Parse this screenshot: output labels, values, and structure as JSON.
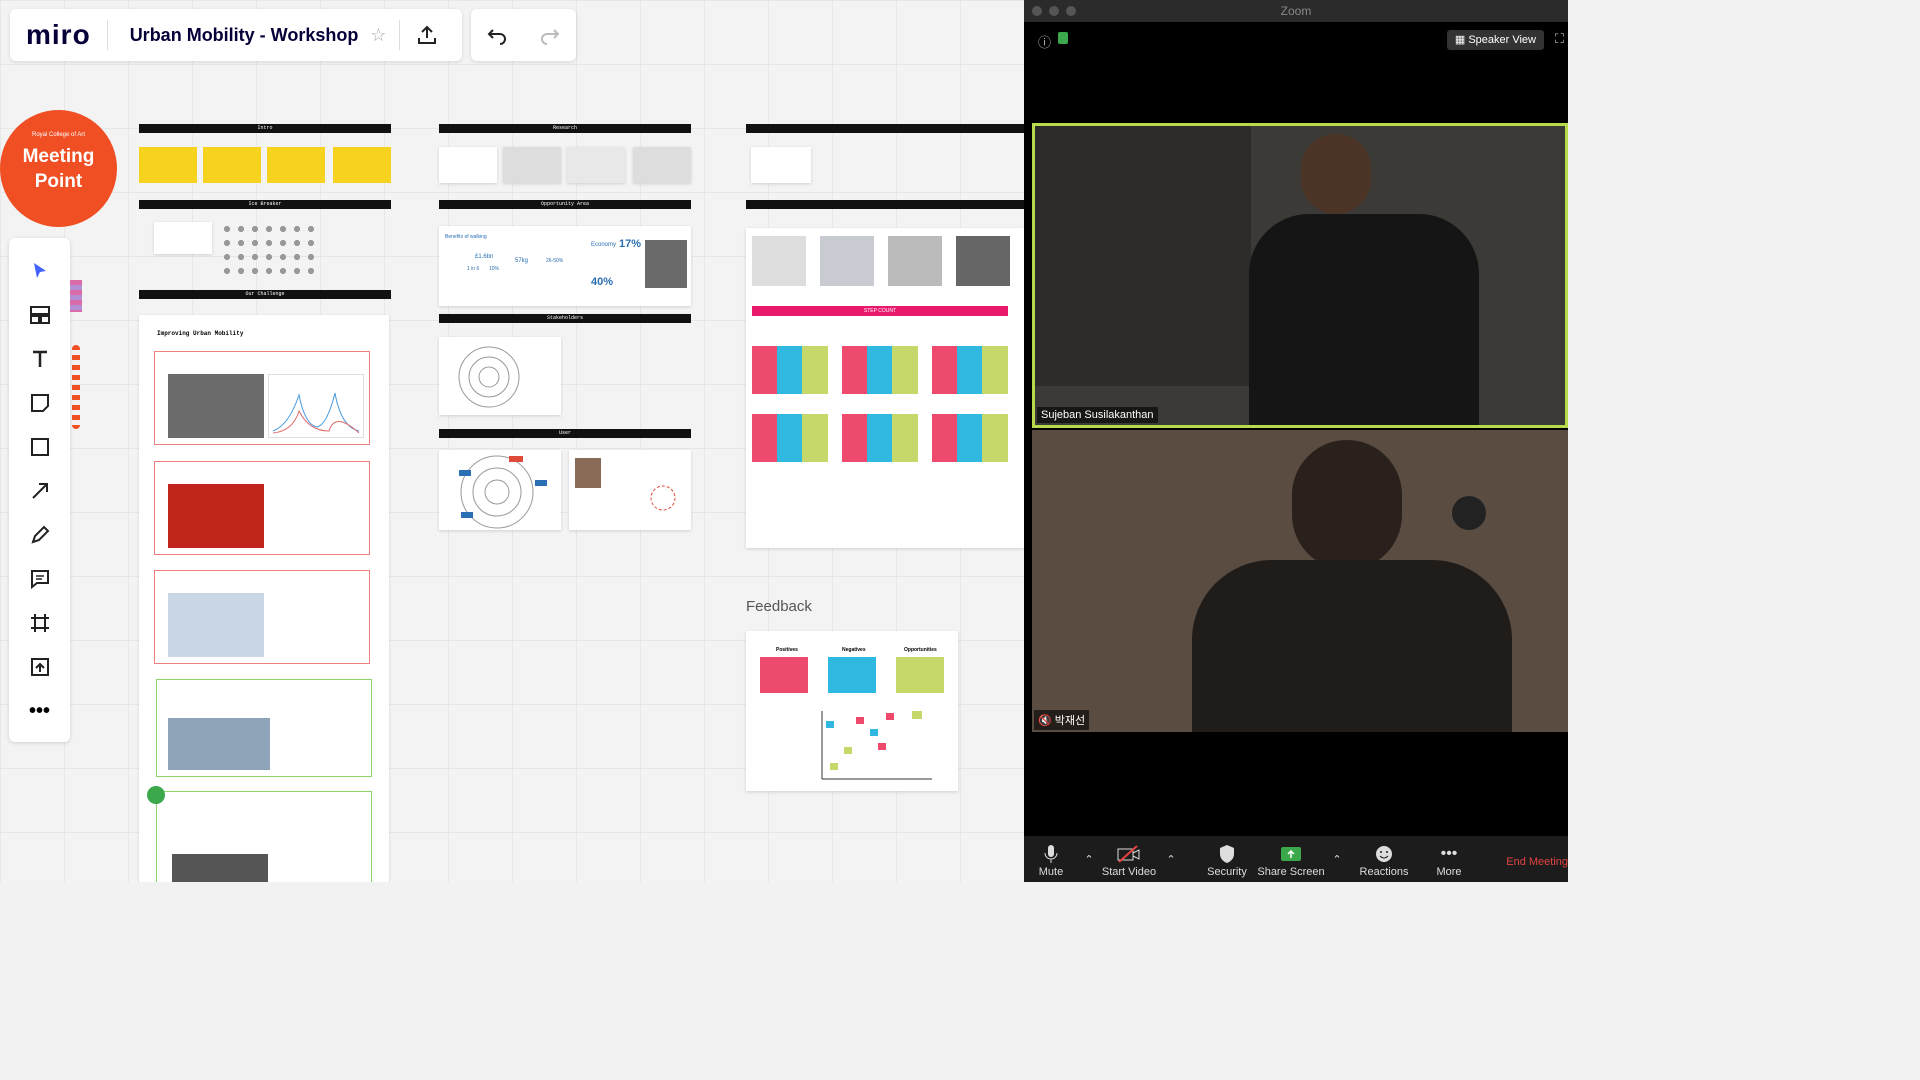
{
  "board": {
    "logo": "miro",
    "title": "Urban Mobility - Workshop",
    "meeting_point": {
      "org": "Royal College of Art",
      "line1": "Meeting",
      "line2": "Point"
    },
    "frames": {
      "intro": "Intro",
      "ice_breaker": "Ice Breaker",
      "our_challenge": "Our Challenge",
      "research": "Research",
      "opportunity_area": "Opportunity Area",
      "stakeholders": "Stakeholders",
      "user": "User",
      "improving": "Improving Urban Mobility",
      "step_count": "STEP COUNT"
    },
    "feedback": {
      "label": "Feedback",
      "cols": [
        "Positives",
        "Negatives",
        "Opportunities"
      ]
    },
    "economy": {
      "title": "Economy",
      "pct1": "17%",
      "pct2": "40%",
      "benefit": "Benefits of walking",
      "amount": "£1.6bn",
      "ratio": "1 in 6",
      "pct3": "10%",
      "weight": "57kg",
      "range": "26-50%"
    }
  },
  "tools": [
    "select-icon",
    "template-icon",
    "text-icon",
    "sticky-icon",
    "shape-icon",
    "arrow-icon",
    "pen-icon",
    "comment-icon",
    "frame-icon",
    "upload-icon",
    "more-icon"
  ],
  "zoom": {
    "window_title": "Zoom",
    "view_label": "Speaker View",
    "participants": [
      "Sujeban Susilakanthan",
      "박재선"
    ],
    "toolbar": [
      "Mute",
      "Start Video",
      "Security",
      "Share Screen",
      "Reactions",
      "More"
    ],
    "end": "End Meeting"
  },
  "colors": {
    "accent_red": "#f04e23",
    "sticky_yellow": "#f7d21e",
    "pink": "#ee4a6e",
    "cyan": "#2fb9e0",
    "lime": "#c7d86a",
    "speaker_border": "#b7d94b"
  }
}
